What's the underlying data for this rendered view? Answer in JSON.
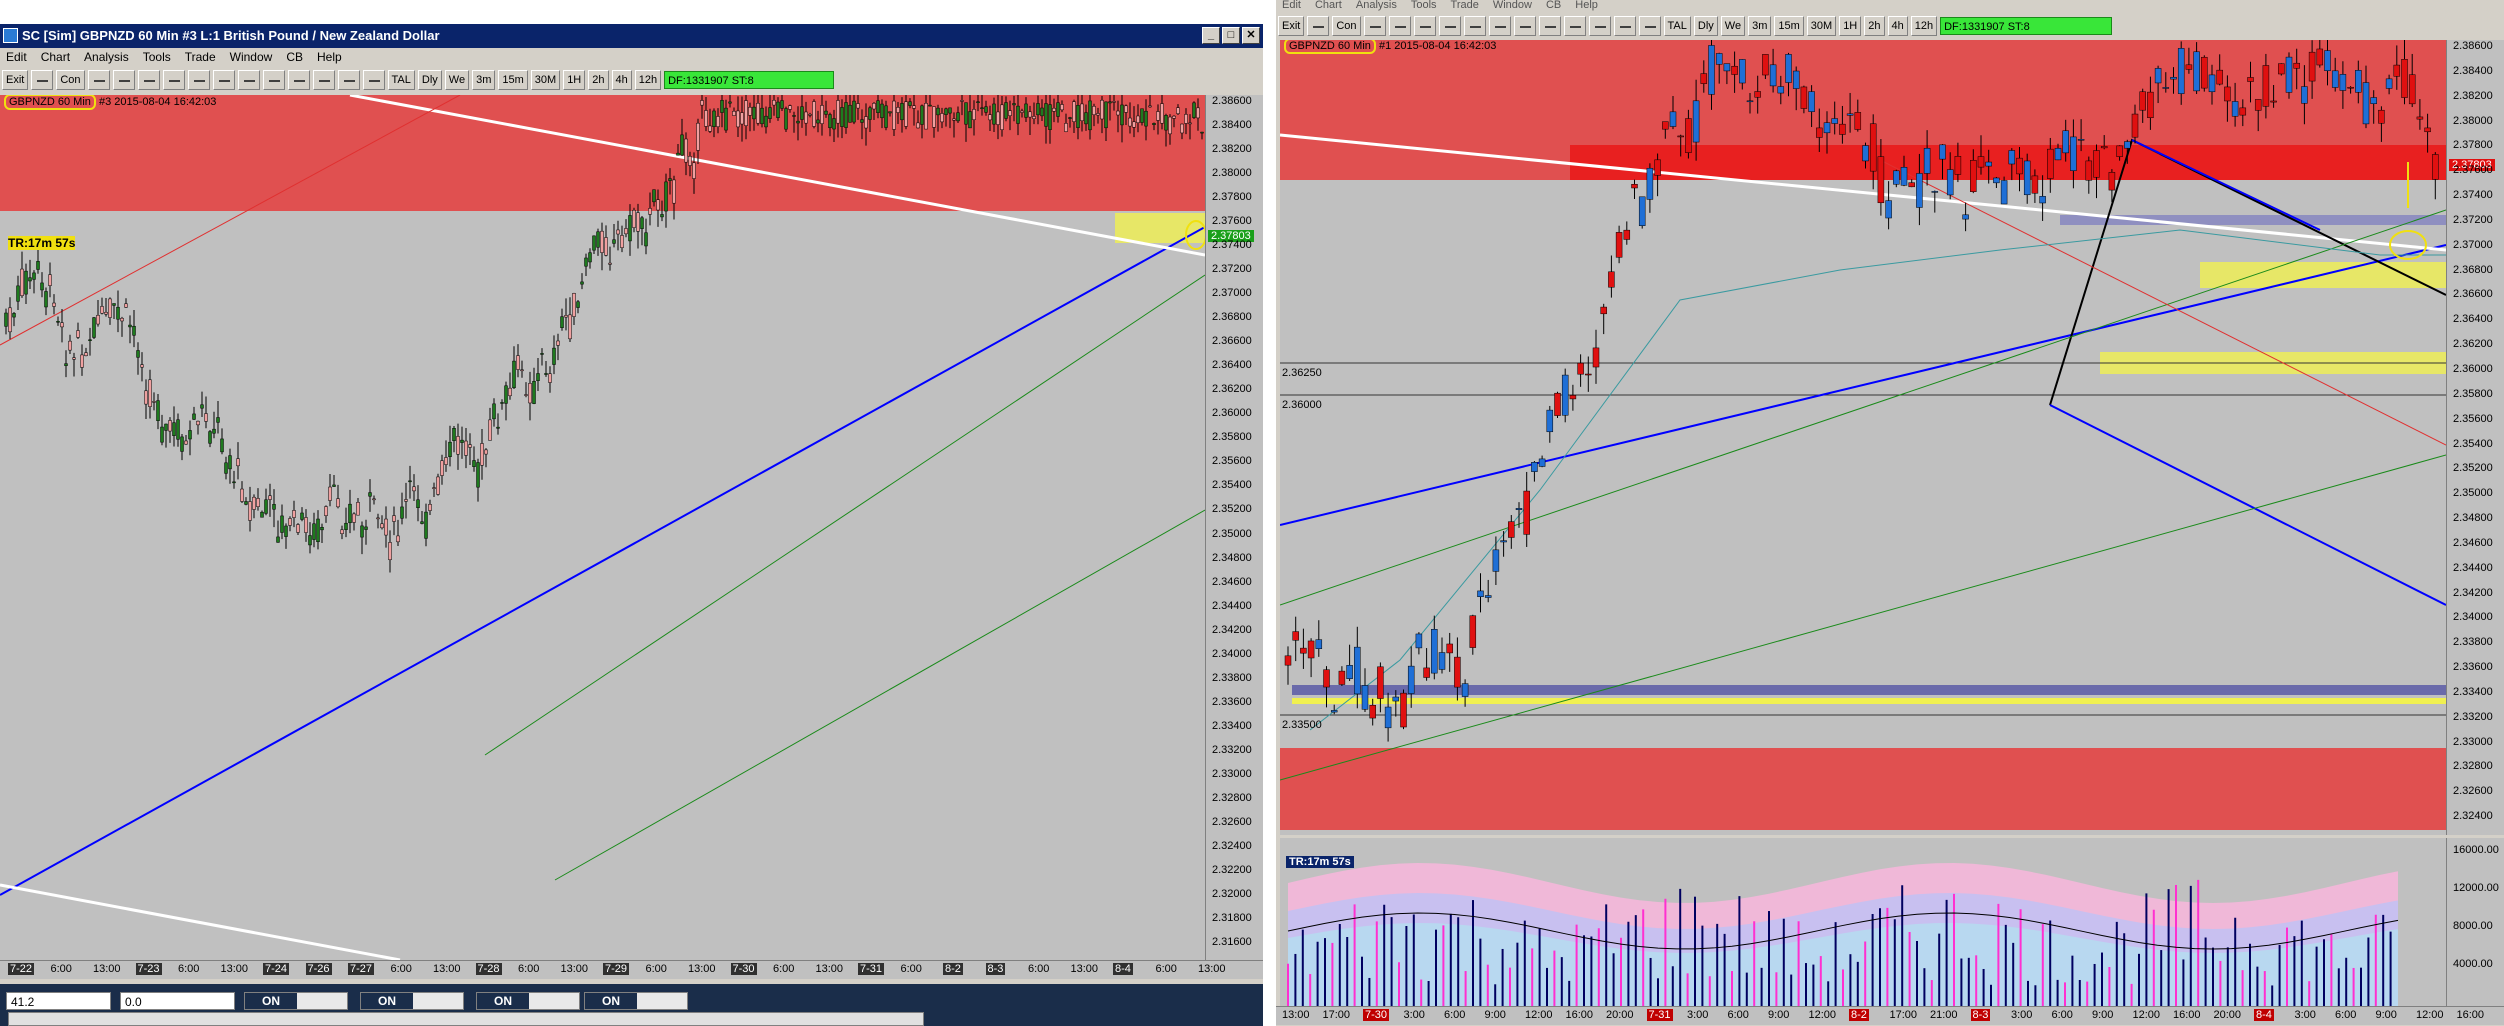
{
  "left_window": {
    "title": "SC [Sim] GBPNZD  60 Min  #3  L:1  British Pound / New Zealand Dollar",
    "menu": [
      "Edit",
      "Chart",
      "Analysis",
      "Tools",
      "Trade",
      "Window",
      "CB",
      "Help"
    ],
    "toolbar": {
      "exit": "Exit",
      "con": "Con",
      "tal": "TAL",
      "periods": [
        "Dly",
        "We",
        "3m",
        "15m",
        "30M",
        "1H",
        "2h",
        "4h",
        "12h"
      ],
      "df": "DF:1331907  ST:8"
    },
    "chart_info": {
      "symbol": "GBPNZD  60 Min",
      "rest": "#3 2015-08-04 16:42:03"
    },
    "tr_label": "TR:17m 57s",
    "price_tag": "2.37803",
    "y_ticks": [
      "2.38600",
      "2.38400",
      "2.38200",
      "2.38000",
      "2.37800",
      "2.37600",
      "2.37400",
      "2.37200",
      "2.37000",
      "2.36800",
      "2.36600",
      "2.36400",
      "2.36200",
      "2.36000",
      "2.35800",
      "2.35600",
      "2.35400",
      "2.35200",
      "2.35000",
      "2.34800",
      "2.34600",
      "2.34400",
      "2.34200",
      "2.34000",
      "2.33800",
      "2.33600",
      "2.33400",
      "2.33200",
      "2.33000",
      "2.32800",
      "2.32600",
      "2.32400",
      "2.32200",
      "2.32000",
      "2.31800",
      "2.31600"
    ],
    "x_ticks": [
      {
        "t": "7-22",
        "d": true
      },
      {
        "t": "6:00"
      },
      {
        "t": "13:00"
      },
      {
        "t": "7-23",
        "d": true
      },
      {
        "t": "6:00"
      },
      {
        "t": "13:00"
      },
      {
        "t": "7-24",
        "d": true
      },
      {
        "t": "7-26",
        "d": true
      },
      {
        "t": "7-27",
        "d": true
      },
      {
        "t": "6:00"
      },
      {
        "t": "13:00"
      },
      {
        "t": "7-28",
        "d": true
      },
      {
        "t": "6:00"
      },
      {
        "t": "13:00"
      },
      {
        "t": "7-29",
        "d": true
      },
      {
        "t": "6:00"
      },
      {
        "t": "13:00"
      },
      {
        "t": "7-30",
        "d": true
      },
      {
        "t": "6:00"
      },
      {
        "t": "13:00"
      },
      {
        "t": "7-31",
        "d": true
      },
      {
        "t": "6:00"
      },
      {
        "t": "8-2",
        "d": true
      },
      {
        "t": "8-3",
        "d": true
      },
      {
        "t": "6:00"
      },
      {
        "t": "13:00"
      },
      {
        "t": "8-4",
        "d": true
      },
      {
        "t": "6:00"
      },
      {
        "t": "13:00"
      }
    ],
    "bottom": {
      "qty": "41.2",
      "offset": "0.0",
      "toggles": [
        "ON",
        "ON",
        "ON",
        "ON"
      ]
    }
  },
  "right_window": {
    "menu": [
      "Edit",
      "Chart",
      "Analysis",
      "Tools",
      "Trade",
      "Window",
      "CB",
      "Help"
    ],
    "toolbar": {
      "exit": "Exit",
      "con": "Con",
      "tal": "TAL",
      "periods": [
        "Dly",
        "We",
        "3m",
        "15m",
        "30M",
        "1H",
        "2h",
        "4h",
        "12h"
      ],
      "df": "DF:1331907  ST:8"
    },
    "chart_info": {
      "symbol": "GBPNZD  60 Min",
      "rest": "#1 2015-08-04 16:42:03"
    },
    "price_tag": "2.37803",
    "level_labels": [
      "2.36250",
      "2.36000",
      "2.33500"
    ],
    "y_ticks": [
      "2.38600",
      "2.38400",
      "2.38200",
      "2.38000",
      "2.37800",
      "2.37600",
      "2.37400",
      "2.37200",
      "2.37000",
      "2.36800",
      "2.36600",
      "2.36400",
      "2.36200",
      "2.36000",
      "2.35800",
      "2.35600",
      "2.35400",
      "2.35200",
      "2.35000",
      "2.34800",
      "2.34600",
      "2.34400",
      "2.34200",
      "2.34000",
      "2.33800",
      "2.33600",
      "2.33400",
      "2.33200",
      "2.33000",
      "2.32800",
      "2.32600",
      "2.32400"
    ],
    "volume": {
      "tr_label": "TR:17m 57s",
      "y_ticks": [
        "16000.00",
        "12000.00",
        "8000.00",
        "4000.00"
      ]
    },
    "x_ticks": [
      {
        "t": "13:00"
      },
      {
        "t": "17:00"
      },
      {
        "t": "7-30",
        "d": true
      },
      {
        "t": "3:00"
      },
      {
        "t": "6:00"
      },
      {
        "t": "9:00"
      },
      {
        "t": "12:00"
      },
      {
        "t": "16:00"
      },
      {
        "t": "20:00"
      },
      {
        "t": "7-31",
        "d": true
      },
      {
        "t": "3:00"
      },
      {
        "t": "6:00"
      },
      {
        "t": "9:00"
      },
      {
        "t": "12:00"
      },
      {
        "t": "8-2",
        "d": true
      },
      {
        "t": "17:00"
      },
      {
        "t": "21:00"
      },
      {
        "t": "8-3",
        "d": true
      },
      {
        "t": "3:00"
      },
      {
        "t": "6:00"
      },
      {
        "t": "9:00"
      },
      {
        "t": "12:00"
      },
      {
        "t": "16:00"
      },
      {
        "t": "20:00"
      },
      {
        "t": "8-4",
        "d": true
      },
      {
        "t": "3:00"
      },
      {
        "t": "6:00"
      },
      {
        "t": "9:00"
      },
      {
        "t": "12:00"
      },
      {
        "t": "16:00"
      }
    ]
  },
  "colors": {
    "up_candle_left": "#1e7a1e",
    "down_candle_left": "#f0a0a0",
    "up_candle_right": "#1f6fd6",
    "down_candle_right": "#e01010",
    "supply_zone": "#e05050",
    "demand_zone": "#e05050",
    "highlight": "#f0f050",
    "trendline": "#0000ff"
  }
}
